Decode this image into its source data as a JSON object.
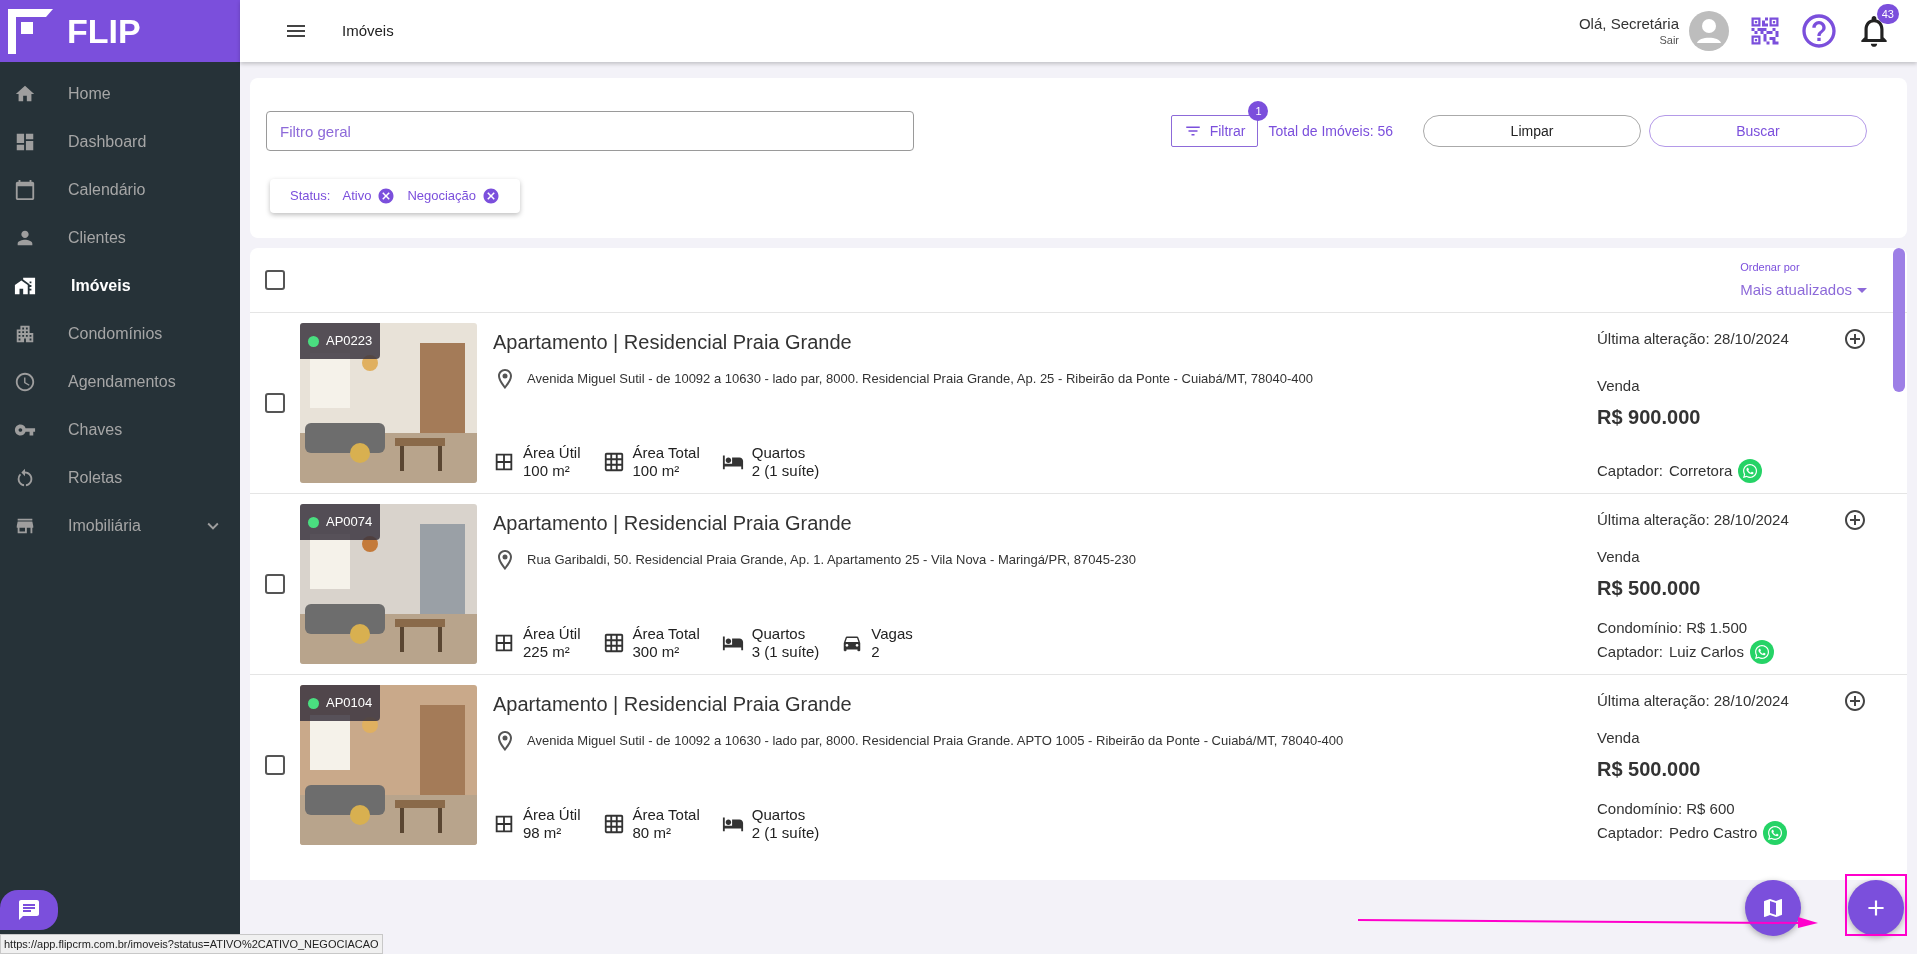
{
  "brand": {
    "name": "FLIP"
  },
  "sidebar": {
    "items": [
      {
        "label": "Home",
        "selected": false
      },
      {
        "label": "Dashboard",
        "selected": false
      },
      {
        "label": "Calendário",
        "selected": false
      },
      {
        "label": "Clientes",
        "selected": false
      },
      {
        "label": "Imóveis",
        "selected": true
      },
      {
        "label": "Condomínios",
        "selected": false
      },
      {
        "label": "Agendamentos",
        "selected": false
      },
      {
        "label": "Chaves",
        "selected": false
      },
      {
        "label": "Roletas",
        "selected": false
      },
      {
        "label": "Imobiliária",
        "selected": false,
        "expanded": false
      }
    ]
  },
  "header": {
    "title": "Imóveis",
    "greeting": "Olá, Secretária",
    "logout": "Sair",
    "notification_count": "43"
  },
  "filters": {
    "search_placeholder": "Filtro geral",
    "filter_button": "Filtrar",
    "filter_count": "1",
    "total": "Total de Imóveis: 56",
    "clear_button": "Limpar",
    "search_button": "Buscar",
    "chip": {
      "label": "Status:",
      "values": [
        "Ativo",
        "Negociação"
      ]
    }
  },
  "list": {
    "select_all": {
      "checked": false
    },
    "sort_label": "Ordenar por",
    "sort_value": "Mais atualizados",
    "rows": [
      {
        "code": "AP0223",
        "color": "#4ade80",
        "checked": false,
        "title": "Apartamento | Residencial Praia Grande",
        "address": "Avenida Miguel Sutil - de 10092 a 10630 - lado par, 8000. Residencial Praia Grande, Ap. 25 - Ribeirão da Ponte - Cuiabá/MT, 78040-400",
        "features": [
          {
            "kind": "util",
            "label": "Área Útil",
            "value": "100 m²"
          },
          {
            "kind": "total",
            "label": "Área Total",
            "value": "100 m²"
          },
          {
            "kind": "rooms",
            "label": "Quartos",
            "value": "2 (1 suíte)"
          }
        ],
        "updated": "Última alteração: 28/10/2024",
        "deal": "Venda",
        "price": "R$ 900.000",
        "agent_label": "Captador:",
        "agent": "Corretora"
      },
      {
        "code": "AP0074",
        "color": "#4ade80",
        "checked": false,
        "title": "Apartamento | Residencial Praia Grande",
        "address": "Rua Garibaldi, 50. Residencial Praia Grande, Ap. 1. Apartamento 25 - Vila Nova - Maringá/PR, 87045-230",
        "features": [
          {
            "kind": "util",
            "label": "Área Útil",
            "value": "225 m²"
          },
          {
            "kind": "total",
            "label": "Área Total",
            "value": "300 m²"
          },
          {
            "kind": "rooms",
            "label": "Quartos",
            "value": "3 (1 suíte)"
          },
          {
            "kind": "parking",
            "label": "Vagas",
            "value": "2"
          }
        ],
        "updated": "Última alteração: 28/10/2024",
        "deal": "Venda",
        "price": "R$ 500.000",
        "condo": "Condomínio: R$ 1.500",
        "agent_label": "Captador:",
        "agent": "Luiz Carlos"
      },
      {
        "code": "AP0104",
        "color": "#4ade80",
        "checked": false,
        "title": "Apartamento | Residencial Praia Grande",
        "address": "Avenida Miguel Sutil - de 10092 a 10630 - lado par, 8000. Residencial Praia Grande. APTO 1005 - Ribeirão da Ponte - Cuiabá/MT, 78040-400",
        "features": [
          {
            "kind": "util",
            "label": "Área Útil",
            "value": "98 m²"
          },
          {
            "kind": "total",
            "label": "Área Total",
            "value": "80 m²"
          },
          {
            "kind": "rooms",
            "label": "Quartos",
            "value": "2 (1 suíte)"
          }
        ],
        "updated": "Última alteração: 28/10/2024",
        "deal": "Venda",
        "price": "R$ 500.000",
        "condo": "Condomínio: R$ 600",
        "agent_label": "Captador:",
        "agent": "Pedro Castro"
      }
    ]
  },
  "status_url": "https://app.flipcrm.com.br/imoveis?status=ATIVO%2CATIVO_NEGOCIACAO"
}
